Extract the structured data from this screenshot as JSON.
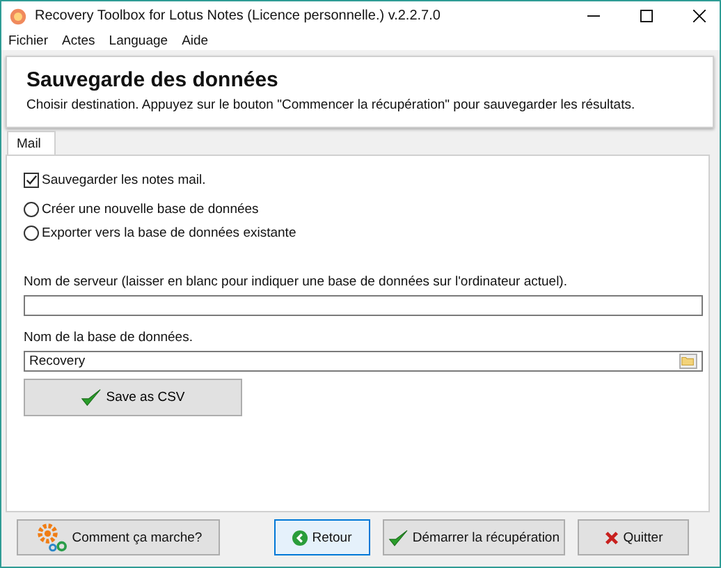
{
  "window": {
    "title": "Recovery Toolbox for Lotus Notes (Licence personnelle.) v.2.2.7.0"
  },
  "menu": [
    "Fichier",
    "Actes",
    "Language",
    "Aide"
  ],
  "header": {
    "title": "Sauvegarde des données",
    "subtitle": "Choisir destination. Appuyez sur le bouton \"Commencer la récupération\" pour sauvegarder les résultats."
  },
  "tabs": [
    {
      "label": "Mail",
      "selected": true
    }
  ],
  "save_mail": {
    "label": "Sauvegarder les notes mail.",
    "checked": true
  },
  "options": [
    {
      "label": "Créer une nouvelle base de données",
      "selected": false
    },
    {
      "label": "Exporter vers la base de données existante",
      "selected": false
    }
  ],
  "server": {
    "label": "Nom de serveur (laisser en blanc pour indiquer une base de données sur l'ordinateur actuel)."
  },
  "database": {
    "label": "Nom de la base de données.",
    "value": "Recovery"
  },
  "csv_button": "Save as CSV",
  "footer": [
    {
      "kind": "help",
      "label": "Comment ça marche?",
      "focused": false
    },
    {
      "kind": "back",
      "label": "Retour",
      "focused": true
    },
    {
      "kind": "start",
      "label": "Démarrer la récupération",
      "focused": false
    },
    {
      "kind": "quit",
      "label": "Quitter",
      "focused": false
    }
  ]
}
